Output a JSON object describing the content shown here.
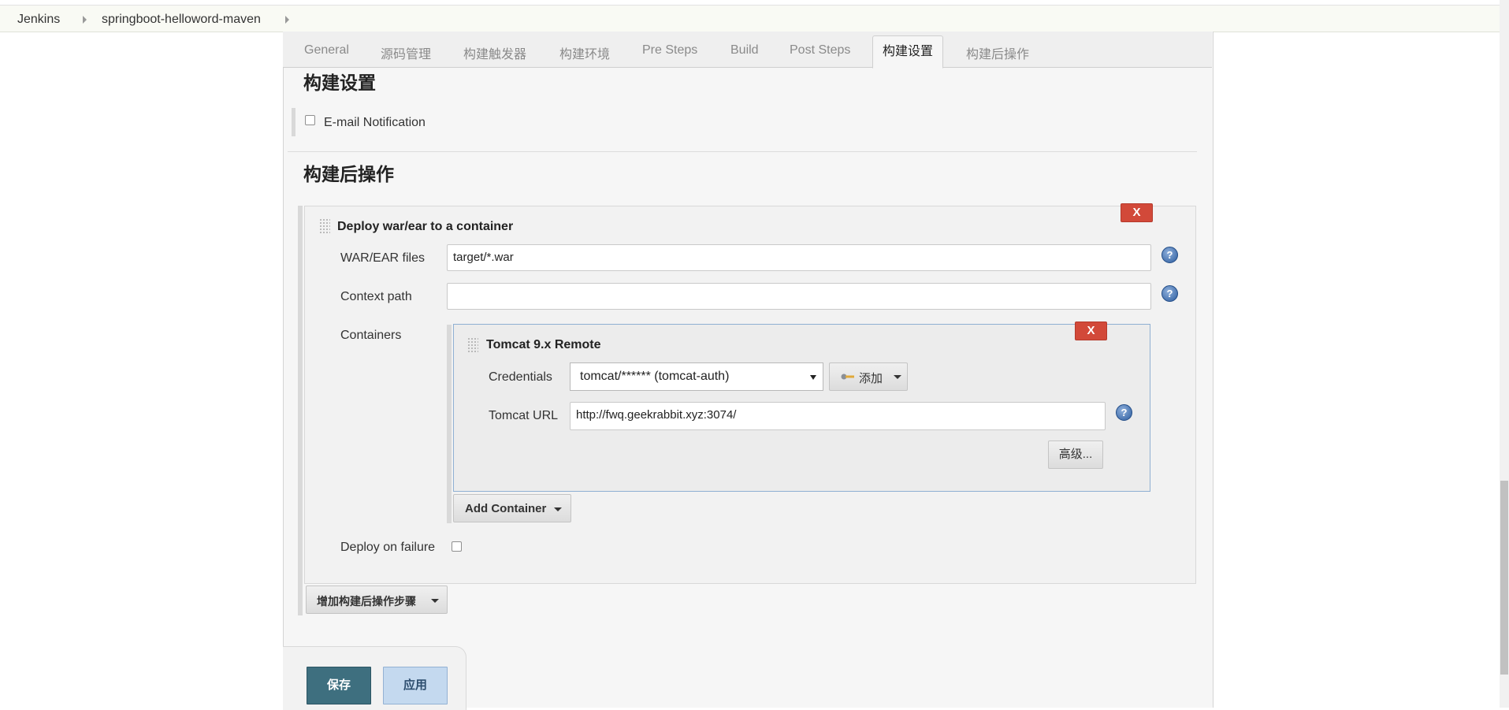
{
  "breadcrumb": [
    "Jenkins",
    "springboot-helloword-maven"
  ],
  "tabs": [
    "General",
    "源码管理",
    "构建触发器",
    "构建环境",
    "Pre Steps",
    "Build",
    "Post Steps",
    "构建设置",
    "构建后操作"
  ],
  "active_tab": "构建设置",
  "build_settings": {
    "title": "构建设置",
    "email_notification": {
      "label": "E-mail Notification",
      "checked": false
    }
  },
  "post_build": {
    "title": "构建后操作",
    "deploy": {
      "title": "Deploy war/ear to a container",
      "remove_label": "X",
      "war_ear_files": {
        "label": "WAR/EAR files",
        "value": "target/*.war"
      },
      "context_path": {
        "label": "Context path",
        "value": ""
      },
      "containers_label": "Containers",
      "container": {
        "title": "Tomcat 9.x Remote",
        "remove_label": "X",
        "credentials": {
          "label": "Credentials",
          "value": "tomcat/****** (tomcat-auth)",
          "add_label": "添加"
        },
        "tomcat_url": {
          "label": "Tomcat URL",
          "value": "http://fwq.geekrabbit.xyz:3074/"
        },
        "advanced_label": "高级..."
      },
      "add_container_label": "Add Container",
      "deploy_on_failure": {
        "label": "Deploy on failure",
        "checked": false
      }
    },
    "add_step_label": "增加构建后操作步骤"
  },
  "actions": {
    "save": "保存",
    "apply": "应用"
  },
  "help_glyph": "?",
  "colors": {
    "danger": "#d24939",
    "save": "#3e6f7f",
    "apply": "#c4d9ef"
  }
}
